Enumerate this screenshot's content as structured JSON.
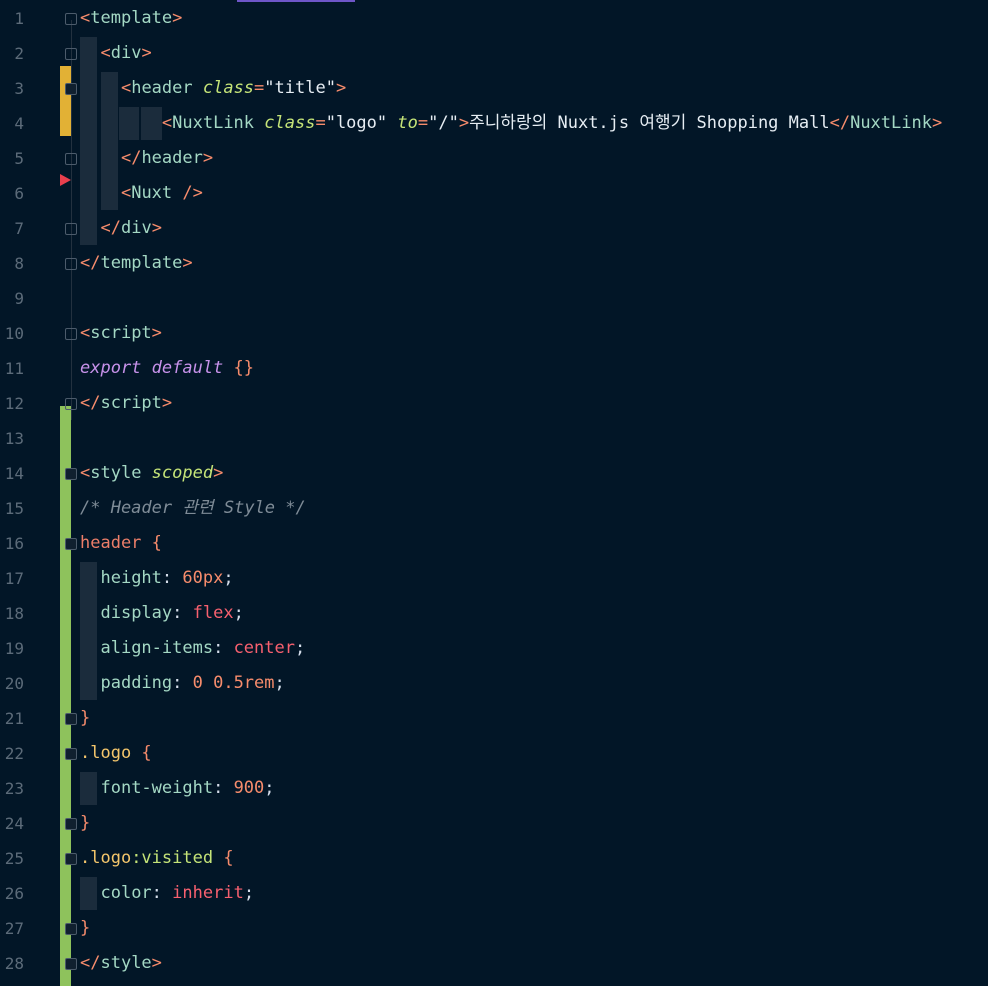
{
  "editor": {
    "lines": [
      {
        "n": "1",
        "tokens": [
          [
            "p",
            "<"
          ],
          [
            "t",
            "template"
          ],
          [
            "p",
            ">"
          ]
        ]
      },
      {
        "n": "2",
        "tokens": [
          [
            "plain",
            "  "
          ],
          [
            "p",
            "<"
          ],
          [
            "t",
            "div"
          ],
          [
            "p",
            ">"
          ]
        ]
      },
      {
        "n": "3",
        "tokens": [
          [
            "plain",
            "    "
          ],
          [
            "p",
            "<"
          ],
          [
            "t",
            "header "
          ],
          [
            "a",
            "class"
          ],
          [
            "p",
            "="
          ],
          [
            "s",
            "\"title\""
          ],
          [
            "p",
            ">"
          ]
        ]
      },
      {
        "n": "4",
        "tokens": [
          [
            "plain",
            "        "
          ],
          [
            "p",
            "<"
          ],
          [
            "t",
            "NuxtLink "
          ],
          [
            "a",
            "class"
          ],
          [
            "p",
            "="
          ],
          [
            "s",
            "\"logo\" "
          ],
          [
            "a",
            "to"
          ],
          [
            "p",
            "="
          ],
          [
            "s",
            "\"/\""
          ],
          [
            "p",
            ">"
          ],
          [
            "txt",
            "주니하랑의 Nuxt.js 여행기 Shopping Mall"
          ],
          [
            "p",
            "</"
          ],
          [
            "t",
            "NuxtLink"
          ],
          [
            "p",
            ">"
          ]
        ]
      },
      {
        "n": "5",
        "tokens": [
          [
            "plain",
            "    "
          ],
          [
            "p",
            "</"
          ],
          [
            "t",
            "header"
          ],
          [
            "p",
            ">"
          ]
        ]
      },
      {
        "n": "6",
        "tokens": [
          [
            "plain",
            "    "
          ],
          [
            "p",
            "<"
          ],
          [
            "t",
            "Nuxt "
          ],
          [
            "p",
            "/>"
          ]
        ]
      },
      {
        "n": "7",
        "tokens": [
          [
            "plain",
            "  "
          ],
          [
            "p",
            "</"
          ],
          [
            "t",
            "div"
          ],
          [
            "p",
            ">"
          ]
        ]
      },
      {
        "n": "8",
        "tokens": [
          [
            "p",
            "</"
          ],
          [
            "t",
            "template"
          ],
          [
            "p",
            ">"
          ]
        ]
      },
      {
        "n": "9",
        "tokens": []
      },
      {
        "n": "10",
        "tokens": [
          [
            "p",
            "<"
          ],
          [
            "t",
            "script"
          ],
          [
            "p",
            ">"
          ]
        ]
      },
      {
        "n": "11",
        "tokens": [
          [
            "kw",
            "export default "
          ],
          [
            "p",
            "{}"
          ]
        ]
      },
      {
        "n": "12",
        "tokens": [
          [
            "p",
            "</"
          ],
          [
            "t",
            "script"
          ],
          [
            "p",
            ">"
          ]
        ]
      },
      {
        "n": "13",
        "tokens": []
      },
      {
        "n": "14",
        "tokens": [
          [
            "p",
            "<"
          ],
          [
            "t",
            "style "
          ],
          [
            "a",
            "scoped"
          ],
          [
            "p",
            ">"
          ]
        ]
      },
      {
        "n": "15",
        "tokens": [
          [
            "cm",
            "/* Header 관련 Style */"
          ]
        ]
      },
      {
        "n": "16",
        "tokens": [
          [
            "sel",
            "header "
          ],
          [
            "p",
            "{"
          ]
        ]
      },
      {
        "n": "17",
        "tokens": [
          [
            "plain",
            "  "
          ],
          [
            "prop",
            "height"
          ],
          [
            "plain",
            ": "
          ],
          [
            "num",
            "60px"
          ],
          [
            "plain",
            ";"
          ]
        ]
      },
      {
        "n": "18",
        "tokens": [
          [
            "plain",
            "  "
          ],
          [
            "prop",
            "display"
          ],
          [
            "plain",
            ": "
          ],
          [
            "kwv",
            "flex"
          ],
          [
            "plain",
            ";"
          ]
        ]
      },
      {
        "n": "19",
        "tokens": [
          [
            "plain",
            "  "
          ],
          [
            "prop",
            "align-items"
          ],
          [
            "plain",
            ": "
          ],
          [
            "kwv",
            "center"
          ],
          [
            "plain",
            ";"
          ]
        ]
      },
      {
        "n": "20",
        "tokens": [
          [
            "plain",
            "  "
          ],
          [
            "prop",
            "padding"
          ],
          [
            "plain",
            ": "
          ],
          [
            "num",
            "0 0.5rem"
          ],
          [
            "plain",
            ";"
          ]
        ]
      },
      {
        "n": "21",
        "tokens": [
          [
            "p",
            "}"
          ]
        ]
      },
      {
        "n": "22",
        "tokens": [
          [
            "cls",
            ".logo "
          ],
          [
            "p",
            "{"
          ]
        ]
      },
      {
        "n": "23",
        "tokens": [
          [
            "plain",
            "  "
          ],
          [
            "prop",
            "font-weight"
          ],
          [
            "plain",
            ": "
          ],
          [
            "num",
            "900"
          ],
          [
            "plain",
            ";"
          ]
        ]
      },
      {
        "n": "24",
        "tokens": [
          [
            "p",
            "}"
          ]
        ]
      },
      {
        "n": "25",
        "tokens": [
          [
            "cls",
            ".logo"
          ],
          [
            "ps",
            ":visited "
          ],
          [
            "p",
            "{"
          ]
        ]
      },
      {
        "n": "26",
        "tokens": [
          [
            "plain",
            "  "
          ],
          [
            "prop",
            "color"
          ],
          [
            "plain",
            ": "
          ],
          [
            "kwv",
            "inherit"
          ],
          [
            "plain",
            ";"
          ]
        ]
      },
      {
        "n": "27",
        "tokens": [
          [
            "p",
            "}"
          ]
        ]
      },
      {
        "n": "28",
        "tokens": [
          [
            "p",
            "</"
          ],
          [
            "t",
            "style"
          ],
          [
            "p",
            ">"
          ]
        ]
      }
    ]
  }
}
